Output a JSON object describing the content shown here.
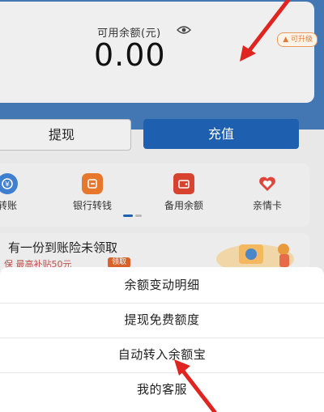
{
  "balance": {
    "label": "可用余额(元)",
    "value": "0.00",
    "upgrade_tag": "可升级"
  },
  "actions": {
    "withdraw": "提现",
    "recharge": "充值"
  },
  "shortcuts": [
    {
      "label": "转账",
      "icon": "transfer-icon"
    },
    {
      "label": "银行转钱",
      "icon": "bank-transfer-icon"
    },
    {
      "label": "备用余额",
      "icon": "wallet-icon"
    },
    {
      "label": "亲情卡",
      "icon": "heart-card-icon"
    }
  ],
  "promo": {
    "title": "有一份到账险未领取",
    "subtitle": "保 最高补贴50元",
    "badge": "领取"
  },
  "sheet": {
    "items": [
      "余额变动明细",
      "提现免费额度",
      "自动转入余额宝",
      "我的客服"
    ]
  },
  "colors": {
    "brand_blue": "#1e5fb0",
    "annotation_red": "#e0241f",
    "upgrade_orange": "#e07a34"
  }
}
